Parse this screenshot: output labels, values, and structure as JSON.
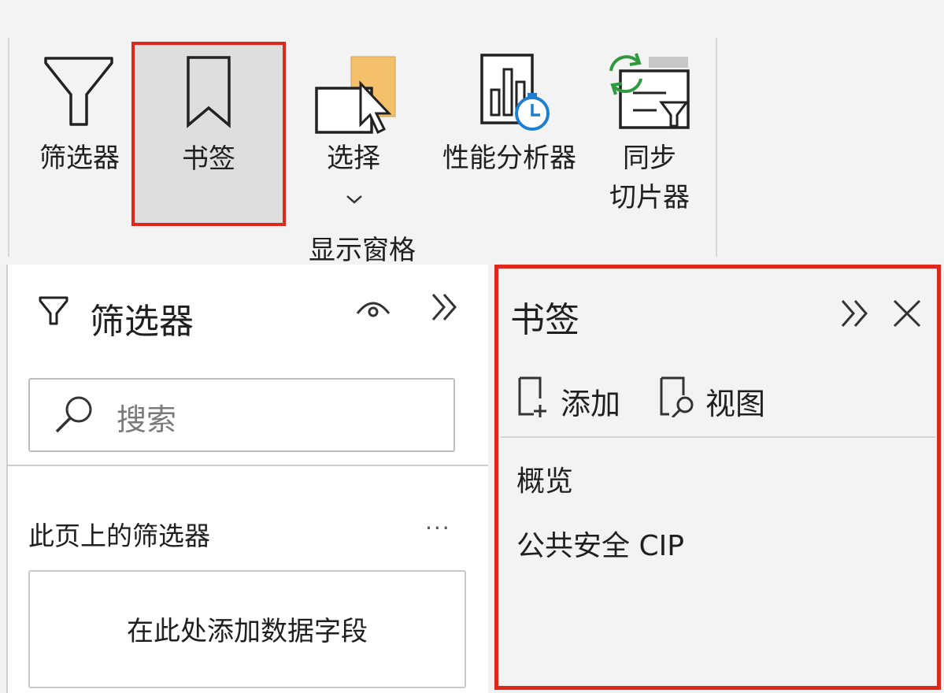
{
  "ribbon": {
    "buttons": [
      {
        "label": "筛选器"
      },
      {
        "label": "书签"
      },
      {
        "label": "选择"
      },
      {
        "label": "性能分析器"
      },
      {
        "label": "同步",
        "label2": "切片器"
      }
    ],
    "group_label": "显示窗格"
  },
  "filters_pane": {
    "title": "筛选器",
    "search_placeholder": "搜索",
    "section_title": "此页上的筛选器",
    "more": "···",
    "drop_hint": "在此处添加数据字段"
  },
  "bookmarks_pane": {
    "title": "书签",
    "add_label": "添加",
    "view_label": "视图",
    "items": [
      {
        "label": "概览"
      },
      {
        "label": "公共安全 CIP"
      }
    ]
  },
  "colors": {
    "highlight": "#e0271c",
    "accent_blue": "#1e7fd1",
    "sync_green": "#2e9a3d",
    "select_orange": "#f5b955"
  }
}
